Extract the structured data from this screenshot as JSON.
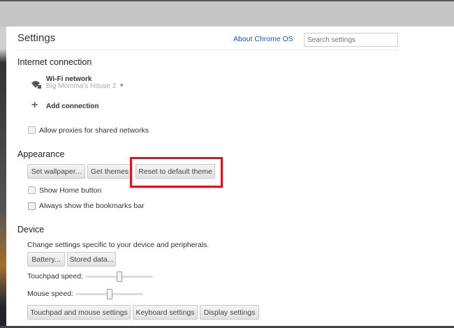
{
  "header": {
    "title": "Settings",
    "about_link": "About Chrome OS",
    "search_placeholder": "Search settings"
  },
  "internet": {
    "heading": "Internet connection",
    "network_type": "Wi-Fi network",
    "network_name": "Big Momma's House 2",
    "add_connection": "Add connection",
    "allow_proxies": "Allow proxies for shared networks",
    "allow_proxies_checked": false
  },
  "appearance": {
    "heading": "Appearance",
    "buttons": [
      "Set wallpaper...",
      "Get themes",
      "Reset to default theme"
    ],
    "show_home": "Show Home button",
    "show_home_checked": false,
    "bookmarks_bar": "Always show the bookmarks bar",
    "bookmarks_bar_checked": false
  },
  "device": {
    "heading": "Device",
    "description": "Change settings specific to your device and peripherals.",
    "buttons": [
      "Battery...",
      "Stored data..."
    ],
    "touchpad_label": "Touchpad speed:",
    "touchpad_value": 0.5,
    "mouse_label": "Mouse speed:",
    "mouse_value": 0.5,
    "bottom_buttons": [
      "Touchpad and mouse settings",
      "Keyboard settings",
      "Display settings"
    ]
  },
  "highlight_color": "#e8101a"
}
